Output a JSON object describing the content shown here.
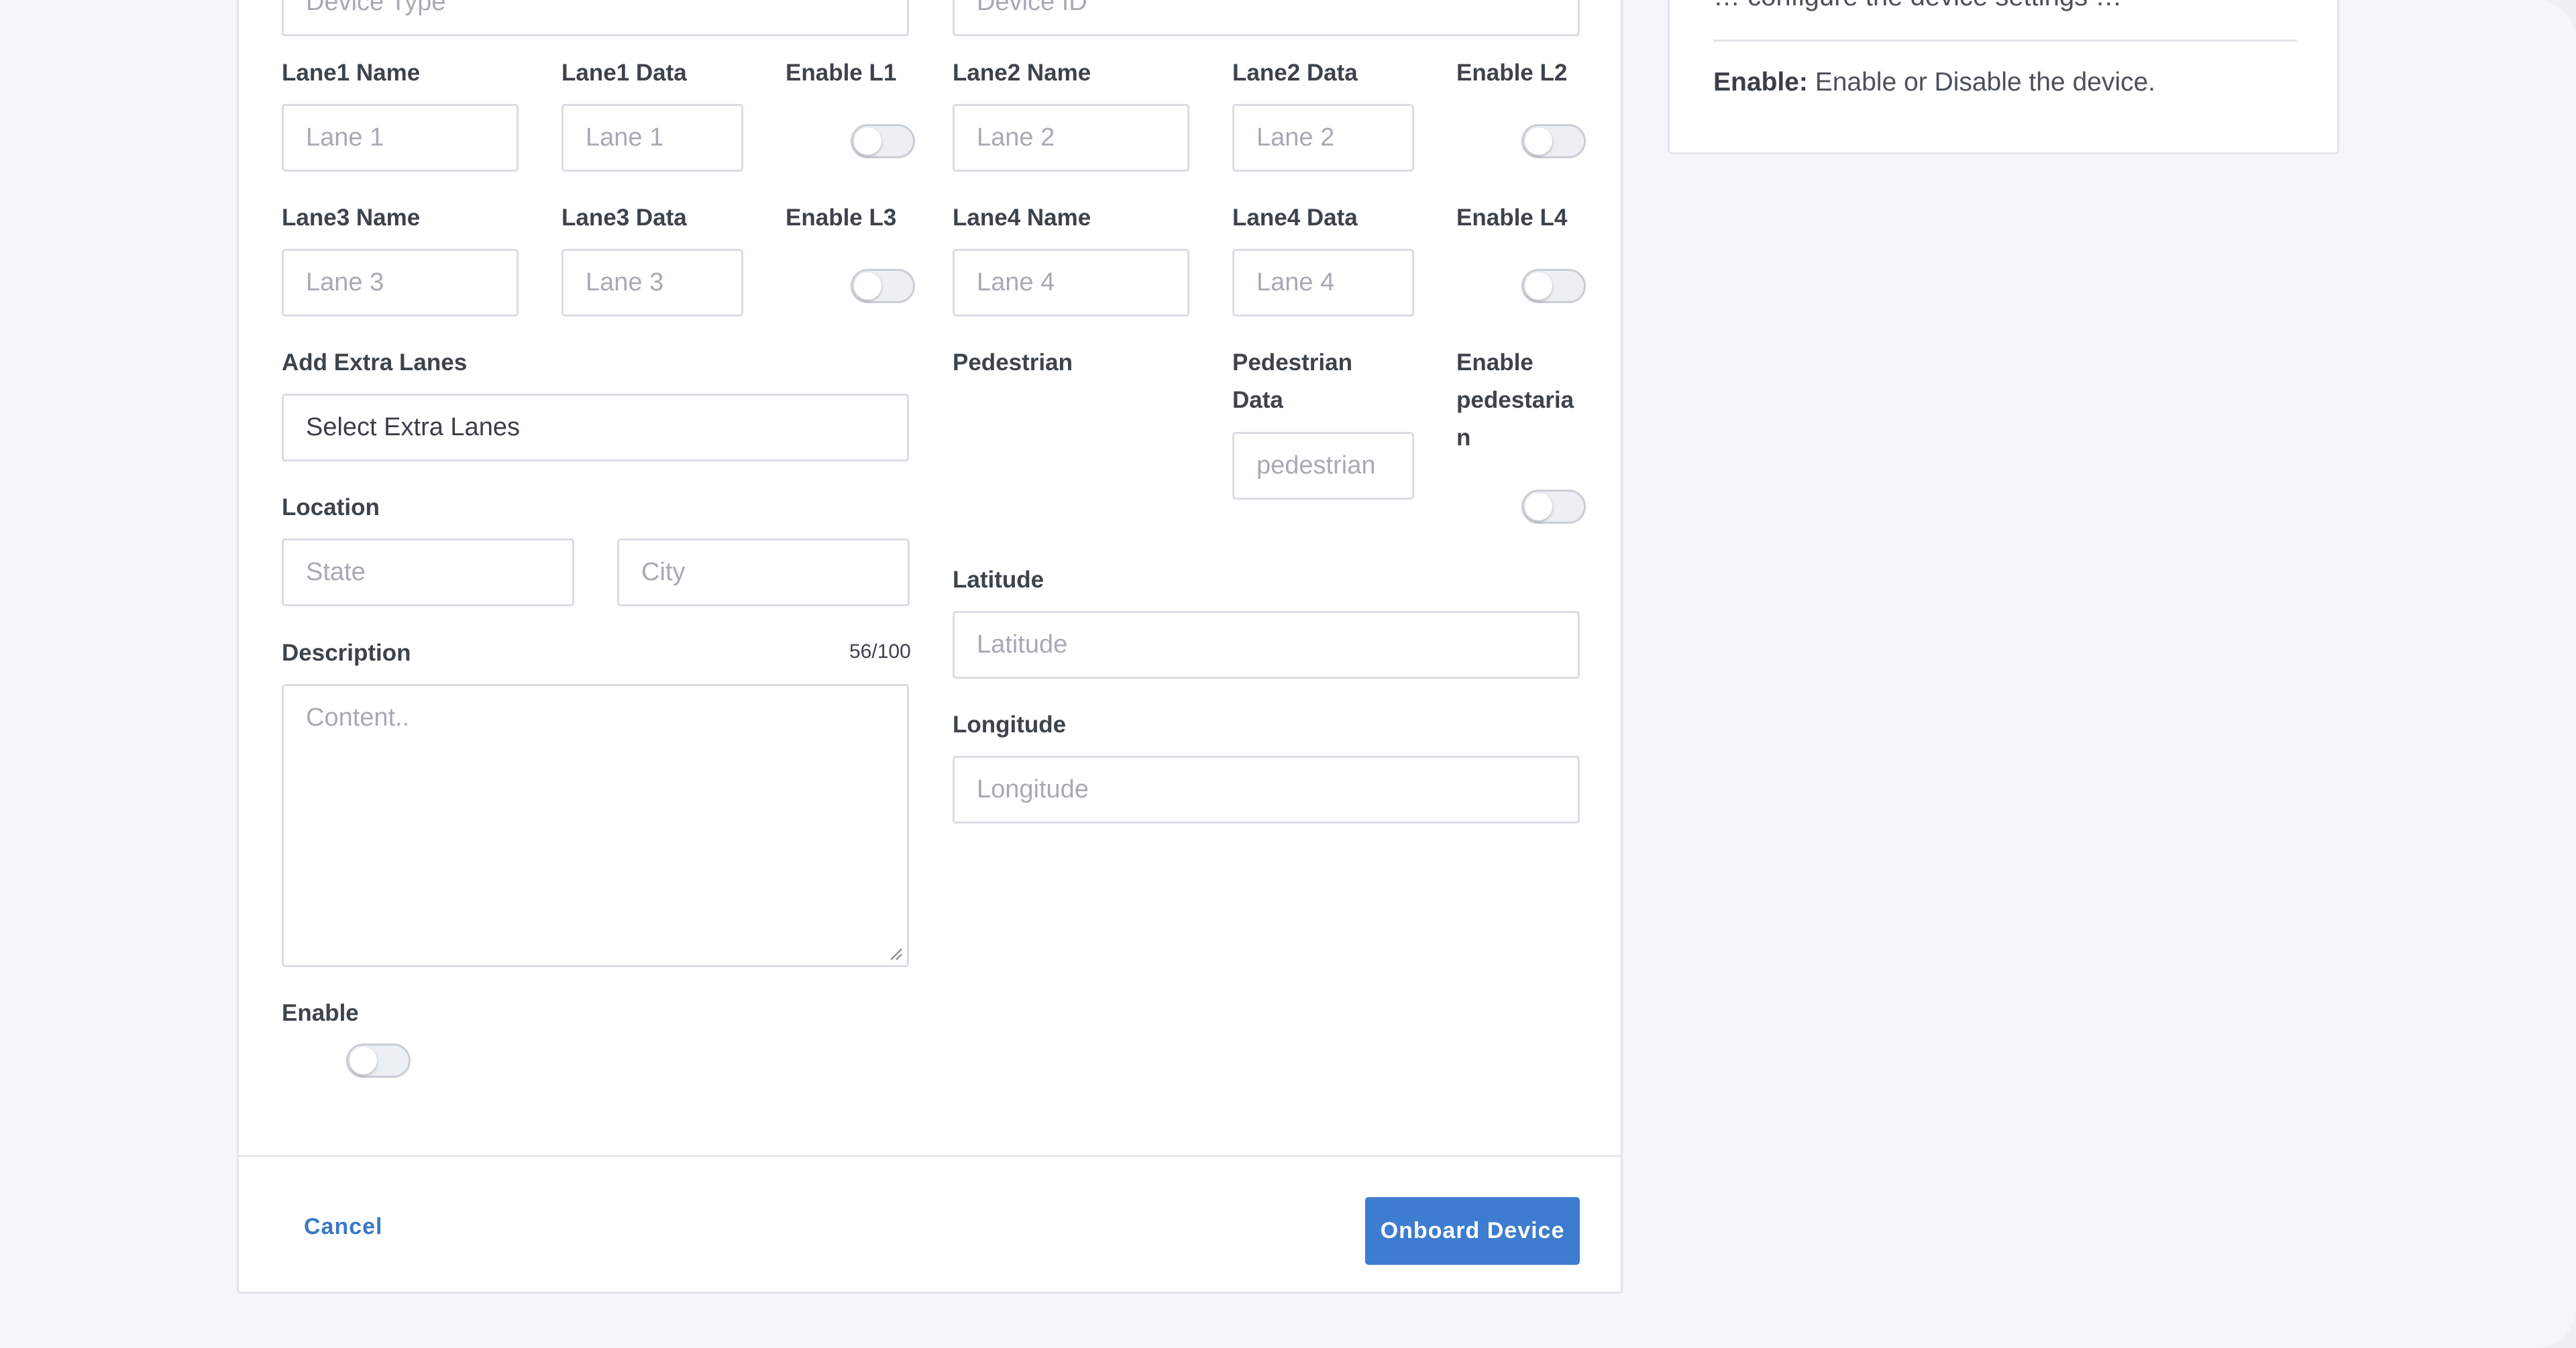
{
  "form": {
    "device_type_placeholder": "Device Type",
    "device_id_placeholder": "Device ID",
    "lane1": {
      "name_label": "Lane1 Name",
      "data_label": "Lane1 Data",
      "enable_label": "Enable L1",
      "name_placeholder": "Lane 1",
      "data_placeholder": "Lane 1"
    },
    "lane2": {
      "name_label": "Lane2 Name",
      "data_label": "Lane2 Data",
      "enable_label": "Enable L2",
      "name_placeholder": "Lane 2",
      "data_placeholder": "Lane 2"
    },
    "lane3": {
      "name_label": "Lane3 Name",
      "data_label": "Lane3 Data",
      "enable_label": "Enable L3",
      "name_placeholder": "Lane 3",
      "data_placeholder": "Lane 3"
    },
    "lane4": {
      "name_label": "Lane4 Name",
      "data_label": "Lane4 Data",
      "enable_label": "Enable L4",
      "name_placeholder": "Lane 4",
      "data_placeholder": "Lane 4"
    },
    "extra_lanes": {
      "label": "Add Extra Lanes",
      "value": "Select Extra Lanes"
    },
    "pedestrian": {
      "label": "Pedestrian",
      "data_label_line1": "Pedestrian",
      "data_label_line2": "Data",
      "data_placeholder": "pedestrian",
      "enable_label_line1": "Enable",
      "enable_label_line2": "pedestaria",
      "enable_label_line3": "n"
    },
    "location": {
      "label": "Location",
      "state_placeholder": "State",
      "city_placeholder": "City"
    },
    "latitude": {
      "label": "Latitude",
      "placeholder": "Latitude"
    },
    "longitude": {
      "label": "Longitude",
      "placeholder": "Longitude"
    },
    "description": {
      "label": "Description",
      "counter": "56/100",
      "placeholder": "Content.."
    },
    "enable": {
      "label": "Enable"
    }
  },
  "toggles": {
    "enable_l1": false,
    "enable_l2": false,
    "enable_l3": false,
    "enable_l4": false,
    "enable_pedestrian": false,
    "enable_device": false
  },
  "footer": {
    "cancel_label": "Cancel",
    "submit_label": "Onboard Device"
  },
  "help": {
    "partial_line": "… configure the device settings …",
    "enable_term": "Enable:",
    "enable_desc": " Enable or Disable the device."
  },
  "colors": {
    "primary": "#3e7ccf",
    "link": "#3b78c3",
    "page_background": "#f5f6f9"
  }
}
